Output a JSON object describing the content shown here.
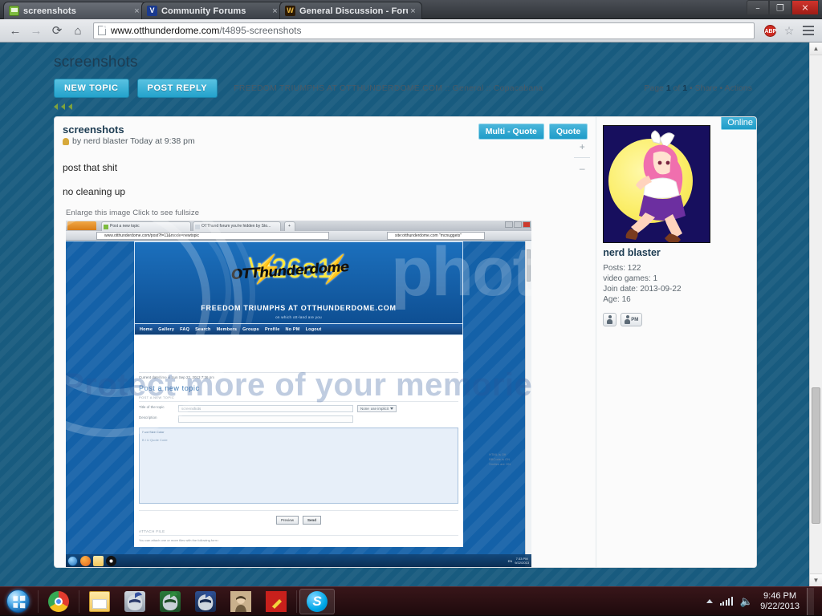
{
  "browser": {
    "tabs": [
      {
        "title": "screenshots",
        "icon": "green-speech-bubble-icon",
        "active": true,
        "close": "×"
      },
      {
        "title": "Community Forums",
        "icon": "v-favicon",
        "active": false,
        "close": "×"
      },
      {
        "title": "General Discussion - Forum",
        "icon": "w-favicon",
        "active": false,
        "close": "×"
      }
    ],
    "window_controls": {
      "minimize": "–",
      "maximize": "❐",
      "close": "✕"
    },
    "nav": {
      "back": "←",
      "forward": "→",
      "reload": "⟳",
      "home": "⌂"
    },
    "address": {
      "host": "www.otthunderdome.com",
      "path": "/t4895-screenshots"
    },
    "toolbar_icons": {
      "adblock": "ABP",
      "bookmark_star": "☆",
      "menu": "menu-icon"
    }
  },
  "forum": {
    "title": "screenshots",
    "buttons": {
      "new_topic": "NEW TOPIC",
      "post_reply": "POST REPLY"
    },
    "breadcrumb": "FREEDOM TRIUMPHS AT OTTHUNDERDOME.COM :: General :: Copacabana",
    "page_info": {
      "prefix": "Page ",
      "current": "1",
      "mid": " of ",
      "total": "1",
      "suffix": " • Share • Actions"
    },
    "post": {
      "subject": "screenshots",
      "meta": "by nerd blaster Today at 9:38 pm",
      "quote_buttons": {
        "multi": "Multi - Quote",
        "single": "Quote"
      },
      "body_lines": [
        "post that shit",
        "no cleaning up"
      ],
      "zoom_controls": {
        "plus": "+",
        "minus": "–"
      },
      "image_caption": "Enlarge this image Click to see fullsize"
    },
    "profile": {
      "online_badge": "Online",
      "username": "nerd blaster",
      "fields": [
        "Posts: 122",
        "video games: 1",
        "Join date: 2013-09-22",
        "Age: 16"
      ],
      "buttons": {
        "profile": "profile-icon",
        "pm": "PM"
      }
    }
  },
  "watermark": {
    "tagline": "Protect more of your memories for less!",
    "brand": "photob"
  },
  "embedded_shot": {
    "firefox": {
      "app_button": "Firefox",
      "tabs": [
        "Post a new topic",
        "OTThund forum you're hidden by Sto..."
      ],
      "new_tab": "+",
      "url": "www.otthunderdome.com/post?f=11&mode=newtopic",
      "search": "site:otthunderdome.com \"mcnuggets\""
    },
    "site": {
      "banner_title": "FREEDOM TRIUMPHS AT OTTHUNDERDOME.COM",
      "banner_sub": "on which ott-land are you",
      "logo_scrawl": "OTThunderdome",
      "nav": [
        "Home",
        "Gallery",
        "FAQ",
        "Search",
        "Members",
        "Groups",
        "Profile",
        "No PM",
        "Logout"
      ],
      "datetime": "Current date/time is Sun Sep 22, 2013 7:36 pm",
      "heading": "Post a new topic",
      "section_label": "POST A NEW TOPIC",
      "fields": [
        {
          "label": "Title of the topic",
          "value": "screenshots"
        },
        {
          "label": "Description",
          "value": ""
        }
      ],
      "icon_select": {
        "none": "None",
        "dropdown": "use implicit"
      },
      "editor": {
        "toolbar": "Font  Size  Color",
        "toolbar2": "B  I  U  Quote  Code"
      },
      "editor_side": [
        "HTML is Off",
        "BBCode is ON",
        "Smilies are ON"
      ],
      "buttons": {
        "preview": "Preview",
        "send": "Send"
      },
      "attach_label": "ATTACH FILE",
      "attach_text": "You can attach one or more files with the following form :"
    },
    "taskbar": {
      "time": "7:33 PM",
      "date": "9/22/2013",
      "lang": "EN"
    }
  },
  "taskbar": {
    "start": "start-orb",
    "pinned": [
      {
        "name": "chrome",
        "label": "Google Chrome"
      },
      {
        "name": "explorer",
        "label": "Windows Explorer"
      },
      {
        "name": "game1",
        "label": "Game"
      },
      {
        "name": "game2",
        "label": "Game"
      },
      {
        "name": "game3",
        "label": "Game"
      },
      {
        "name": "game4",
        "label": "Game"
      },
      {
        "name": "game5",
        "label": "Game"
      },
      {
        "name": "skype",
        "label": "Skype"
      }
    ],
    "tray": {
      "time": "9:46 PM",
      "date": "9/22/2013"
    }
  },
  "colors": {
    "accent_blue": "#23a2cc",
    "page_bg": "#185b7f",
    "forum_heading": "#1d3c52",
    "taskbar": "#3a161a"
  }
}
